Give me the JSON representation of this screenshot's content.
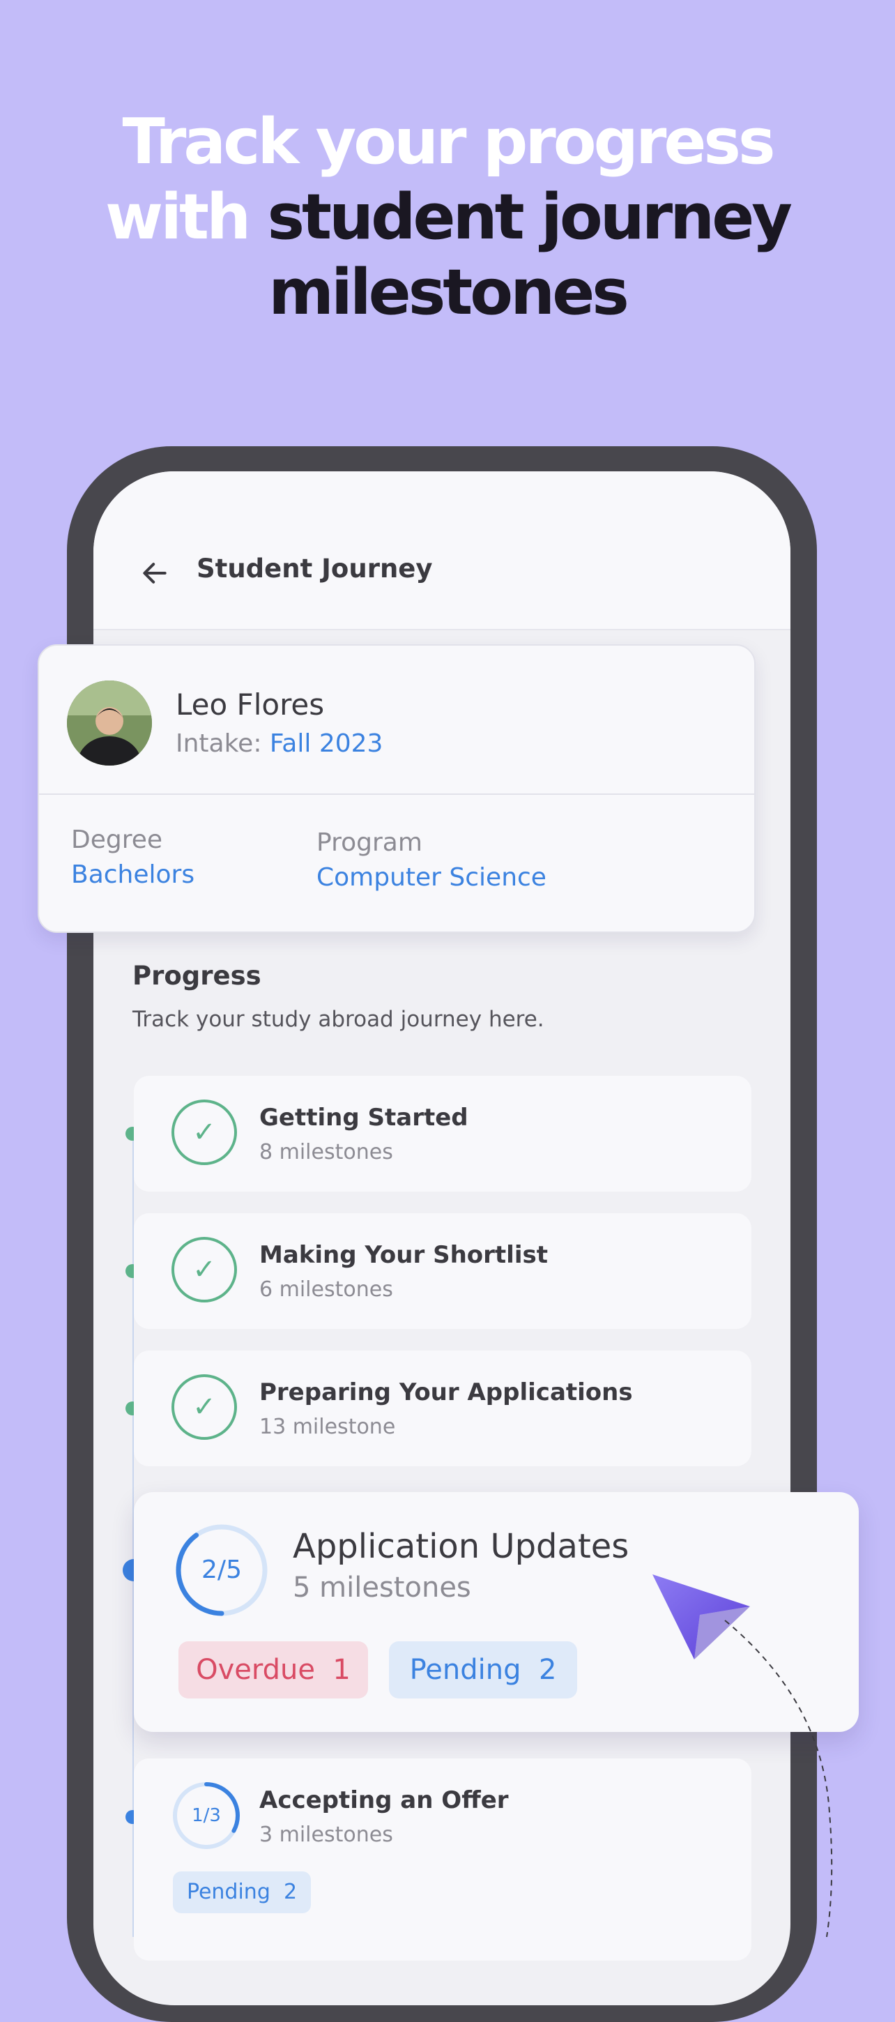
{
  "headline": {
    "line1": "Track your progress",
    "line2_white": "with ",
    "line2_dark": "student journey",
    "line3": "milestones"
  },
  "appbar": {
    "title": "Student Journey"
  },
  "profile": {
    "name": "Leo Flores",
    "intake_label": "Intake: ",
    "intake_value": "Fall 2023",
    "degree_label": "Degree",
    "degree_value": "Bachelors",
    "program_label": "Program",
    "program_value": "Computer Science"
  },
  "progress": {
    "title": "Progress",
    "subtitle": "Track your study abroad journey here."
  },
  "stages": [
    {
      "title": "Getting Started",
      "count": "8 milestones",
      "status": "completed"
    },
    {
      "title": "Making Your Shortlist",
      "count": "6 milestones",
      "status": "completed"
    },
    {
      "title": "Preparing Your Applications",
      "count": "13 milestone",
      "status": "completed"
    }
  ],
  "current_stage": {
    "title": "Application Updates",
    "count": "5 milestones",
    "ring_label": "2/5",
    "fraction": 0.4,
    "overdue_label": "Overdue",
    "overdue_count": "1",
    "pending_label": "Pending",
    "pending_count": "2"
  },
  "next_stage": {
    "title": "Accepting an Offer",
    "count": "3 milestones",
    "ring_label": "1/3",
    "fraction": 0.33,
    "pending_label": "Pending",
    "pending_count": "2"
  },
  "colors": {
    "background": "#c3bcf9",
    "accent_blue": "#3b82e0",
    "success_green": "#5db38a",
    "overdue_red": "#d94b64"
  }
}
